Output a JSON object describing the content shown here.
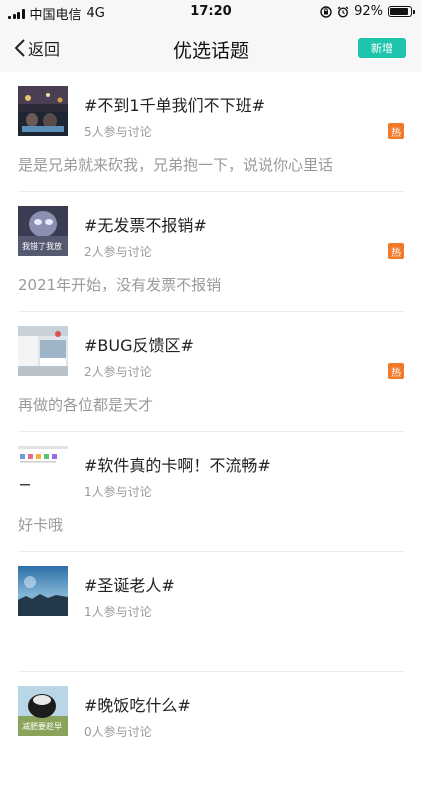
{
  "status": {
    "carrier": "中国电信",
    "network": "4G",
    "time": "17:20",
    "battery": "92%",
    "battery_level": 0.92
  },
  "header": {
    "back_label": "返回",
    "title": "优选话题",
    "new_label": "新增"
  },
  "topics": [
    {
      "title": "#不到1千单我们不下班#",
      "participants": "5人参与讨论",
      "hot": "热",
      "desc": "是是兄弟就来砍我，兄弟抱一下，说说你心里话"
    },
    {
      "title": "#无发票不报销#",
      "participants": "2人参与讨论",
      "hot": "热",
      "desc": "2021年开始，没有发票不报销",
      "thumb_caption": "我错了我放"
    },
    {
      "title": "#BUG反馈区#",
      "participants": "2人参与讨论",
      "hot": "热",
      "desc": "再做的各位都是天才"
    },
    {
      "title": "#软件真的卡啊！不流畅#",
      "participants": "1人参与讨论",
      "desc": "好卡哦"
    },
    {
      "title": "#圣诞老人#",
      "participants": "1人参与讨论",
      "desc": ""
    },
    {
      "title": "#晚饭吃什么#",
      "participants": "0人参与讨论",
      "desc": "",
      "thumb_caption": "减肥要趁早"
    }
  ],
  "colors": {
    "accent": "#1fc4ad",
    "hot": "#f07a2c",
    "muted": "#9a9a9a"
  }
}
